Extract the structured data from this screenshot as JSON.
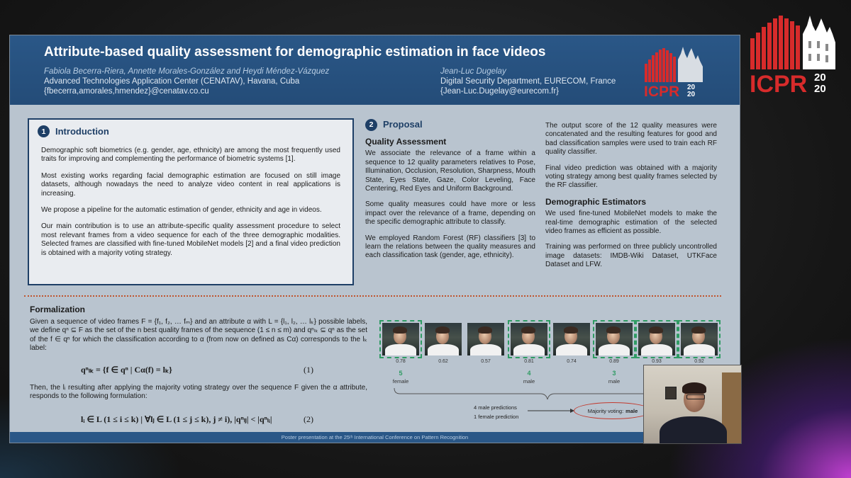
{
  "poster": {
    "title": "Attribute-based quality assessment for demographic estimation in face videos",
    "authors_left": {
      "names": "Fabiola Becerra-Riera, Annette Morales-González and Heydi Méndez-Vázquez",
      "affiliation": "Advanced Technologies Application Center (CENATAV), Havana, Cuba",
      "email": "{fbecerra,amorales,hmendez}@cenatav.co.cu"
    },
    "authors_right": {
      "names": "Jean-Luc Dugelay",
      "affiliation": "Digital Security Department, EURECOM, France",
      "email": "{Jean-Luc.Dugelay@eurecom.fr}"
    },
    "logo_text_top": "ICPR",
    "logo_text_year_a": "20",
    "logo_text_year_b": "20",
    "intro": {
      "num": "1",
      "heading": "Introduction",
      "paragraphs": [
        "Demographic soft biometrics (e.g. gender, age, ethnicity) are among the most frequently used traits for improving and complementing the performance of biometric systems [1].",
        "Most existing works regarding facial demographic estimation are focused on still image datasets, although nowadays the need to analyze video content in real applications is increasing.",
        "We propose a pipeline for the automatic estimation of gender, ethnicity and age in videos.",
        "Our main contribution is to use an attribute-specific quality assessment procedure to select most relevant frames from a video sequence for each of the three demographic modalities. Selected frames are classified with fine-tuned MobileNet models [2] and a final video prediction is obtained with a majority voting strategy."
      ]
    },
    "proposal": {
      "num": "2",
      "heading": "Proposal",
      "quality_heading": "Quality Assessment",
      "col2_paragraphs": [
        "We associate the relevance of a frame within a sequence to 12 quality parameters relatives to Pose, Illumination, Occlusion, Resolution, Sharpness, Mouth State, Eyes State, Gaze, Color Leveling, Face Centering, Red Eyes and Uniform Background.",
        "Some quality measures could have more or less impact over the relevance of a frame, depending on the specific demographic attribute to classify.",
        "We employed Random Forest (RF) classifiers [3] to learn the relations between the quality measures and each classification task (gender, age, ethnicity)."
      ],
      "col3_paragraphs_a": [
        "The output score of the 12 quality measures were concatenated  and the resulting features for good and bad classification samples were used to train each RF quality classifier.",
        "Final video prediction was obtained with a majority voting strategy among best quality frames selected by the RF classifier."
      ],
      "estimators_heading": "Demographic Estimators",
      "col3_paragraphs_b": [
        "We used fine-tuned MobileNet models to make the real-time demographic estimation of the selected video frames as efficient as possible.",
        "Training was performed on three publicly uncontrolled image datasets: IMDB-Wiki Dataset, UTKFace Dataset and LFW."
      ]
    },
    "formalization": {
      "heading": "Formalization",
      "text1": "Given a sequence of video frames F = {f₁, f₂, … fₘ} and an attribute α with L = {l₁, l₂, … lₖ} possible labels, we define qⁿ ⊆ F as the set of the n best quality frames of the sequence (1 ≤ n ≤ m) and qⁿₗₖ ⊆ qⁿ as the set of the f ∈ qⁿ for which the classification according to α (from now on defined as Cα) corresponds to the lₖ label:",
      "eq1": "qⁿₗₖ = {f ∈ qⁿ | Cα(f) = lₖ}",
      "eq1_num": "(1)",
      "text2": "Then, the lᵢ resulting after applying the majority voting strategy over the sequence F given the α attribute, responds to the following formulation:",
      "eq2": "lᵢ ∈ L (1 ≤ i ≤ k) | ∀lⱼ ∈ L (1 ≤ j ≤ k), j ≠ i), |qⁿₗⱼ| < |qⁿₗᵢ|",
      "eq2_num": "(2)"
    },
    "frames": [
      {
        "score": "0.78",
        "selected": true
      },
      {
        "score": "0.62",
        "selected": false
      },
      {
        "score": "0.57",
        "selected": false
      },
      {
        "score": "0.81",
        "selected": true
      },
      {
        "score": "0.74",
        "selected": false
      },
      {
        "score": "0.89",
        "selected": true
      },
      {
        "score": "0.93",
        "selected": true
      },
      {
        "score": "0.92",
        "selected": true
      }
    ],
    "groups": [
      {
        "count": "5",
        "label": "female"
      },
      {
        "count": "4",
        "label": "male"
      },
      {
        "count": "3",
        "label": "male"
      }
    ],
    "predictions": {
      "male": "4 male predictions",
      "female": "1 female prediction"
    },
    "vote": {
      "label": "Majority voting:",
      "result": "male"
    },
    "footer": "Poster presentation at the 25ᵗʰ International Conference on Pattern Recognition"
  },
  "colors": {
    "header_blue": "#2a5787",
    "poster_bg": "#b9c4cf",
    "logo_red": "#d72b2b",
    "selected_green": "#2f9b63",
    "vote_red": "#c23a2e"
  }
}
